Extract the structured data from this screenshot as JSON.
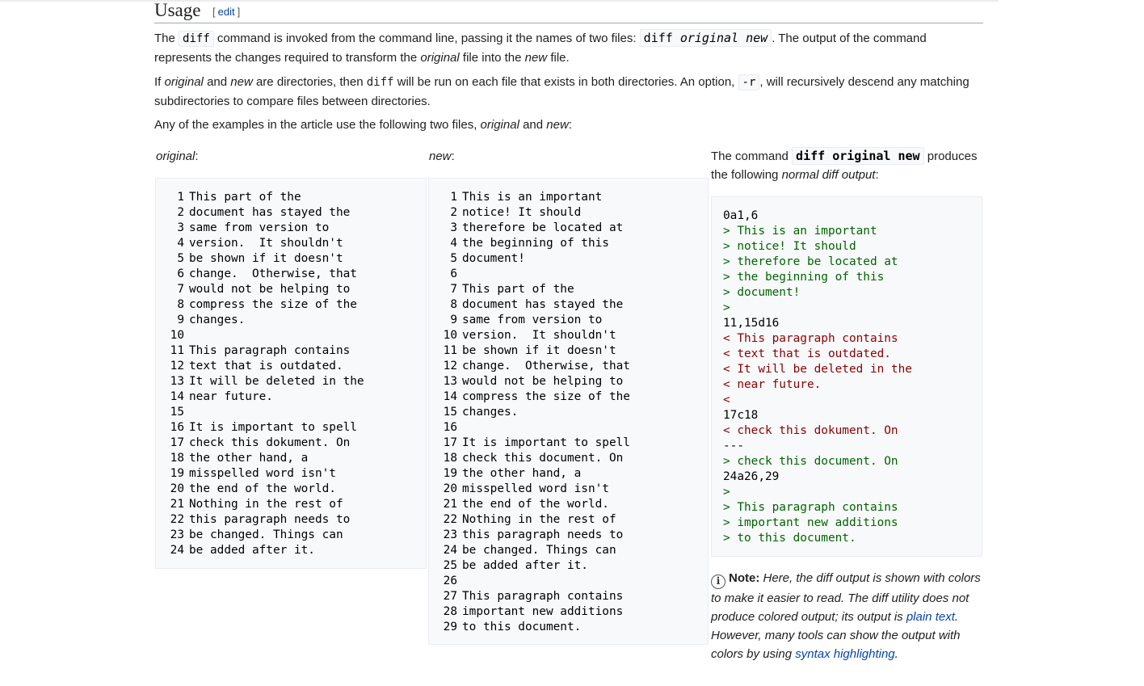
{
  "heading": {
    "title": "Usage",
    "edit_open": "[",
    "edit_label": "edit",
    "edit_close": "]"
  },
  "intro": {
    "p1": {
      "the": "The",
      "cmd": "diff",
      "mid": "command is invoked from the command line, passing it the names of two files:",
      "code_cmd": "diff",
      "code_orig": "original",
      "code_new": "new",
      "after": ". The output of the command represents the changes required to transform the",
      "orig_word": "original",
      "into": "file into the",
      "new_word": "new",
      "end": "file."
    },
    "p2": {
      "if": "If",
      "orig": "original",
      "and": "and",
      "new": "new",
      "mid": "are directories, then",
      "cmd": "diff",
      "mid2": "will be run on each file that exists in both directories. An option,",
      "opt": "-r",
      "end": ", will recursively descend any matching subdirectories to compare files between directories."
    },
    "p3": {
      "text": "Any of the examples in the article use the following two files,",
      "orig": "original",
      "and": "and",
      "new": "new",
      "colon": ":"
    }
  },
  "labels": {
    "original": "original",
    "new": "new",
    "colon": ":",
    "cmd_pre": "The command",
    "cmd_code": "diff original new",
    "cmd_post": "produces the following",
    "cmd_em": "normal diff output",
    "cmd_colon": ":"
  },
  "original_lines": [
    "This part of the",
    "document has stayed the",
    "same from version to",
    "version.  It shouldn't",
    "be shown if it doesn't",
    "change.  Otherwise, that",
    "would not be helping to",
    "compress the size of the",
    "changes.",
    "",
    "This paragraph contains",
    "text that is outdated.",
    "It will be deleted in the",
    "near future.",
    "",
    "It is important to spell",
    "check this dokument. On",
    "the other hand, a",
    "misspelled word isn't",
    "the end of the world.",
    "Nothing in the rest of",
    "this paragraph needs to",
    "be changed. Things can",
    "be added after it."
  ],
  "new_lines": [
    "This is an important",
    "notice! It should",
    "therefore be located at",
    "the beginning of this",
    "document!",
    "",
    "This part of the",
    "document has stayed the",
    "same from version to",
    "version.  It shouldn't",
    "be shown if it doesn't",
    "change.  Otherwise, that",
    "would not be helping to",
    "compress the size of the",
    "changes.",
    "",
    "It is important to spell",
    "check this document. On",
    "the other hand, a",
    "misspelled word isn't",
    "the end of the world.",
    "Nothing in the rest of",
    "this paragraph needs to",
    "be changed. Things can",
    "be added after it.",
    "",
    "This paragraph contains",
    "important new additions",
    "to this document."
  ],
  "diff_lines": [
    {
      "t": "0a1,6",
      "k": "hdr"
    },
    {
      "t": "> This is an important",
      "k": "add"
    },
    {
      "t": "> notice! It should",
      "k": "add"
    },
    {
      "t": "> therefore be located at",
      "k": "add"
    },
    {
      "t": "> the beginning of this",
      "k": "add"
    },
    {
      "t": "> document!",
      "k": "add"
    },
    {
      "t": ">",
      "k": "add"
    },
    {
      "t": "11,15d16",
      "k": "hdr"
    },
    {
      "t": "< This paragraph contains",
      "k": "del"
    },
    {
      "t": "< text that is outdated.",
      "k": "del"
    },
    {
      "t": "< It will be deleted in the",
      "k": "del"
    },
    {
      "t": "< near future.",
      "k": "del"
    },
    {
      "t": "<",
      "k": "del"
    },
    {
      "t": "17c18",
      "k": "hdr"
    },
    {
      "t": "< check this dokument. On",
      "k": "del"
    },
    {
      "t": "---",
      "k": "hdr"
    },
    {
      "t": "> check this document. On",
      "k": "add"
    },
    {
      "t": "24a26,29",
      "k": "hdr"
    },
    {
      "t": ">",
      "k": "add"
    },
    {
      "t": "> This paragraph contains",
      "k": "add"
    },
    {
      "t": "> important new additions",
      "k": "add"
    },
    {
      "t": "> to this document.",
      "k": "add"
    }
  ],
  "colors": {
    "add": "#006400",
    "del": "#8b0000",
    "link": "#0645ad"
  },
  "note": {
    "icon": "info-icon",
    "label": "Note:",
    "text1": "Here, the diff output is shown with colors to make it easier to read. The diff utility does not produce colored output; its output is",
    "link1": "plain text",
    "text2": ". However, many tools can show the output with colors by using",
    "link2": "syntax highlighting",
    "end": "."
  }
}
